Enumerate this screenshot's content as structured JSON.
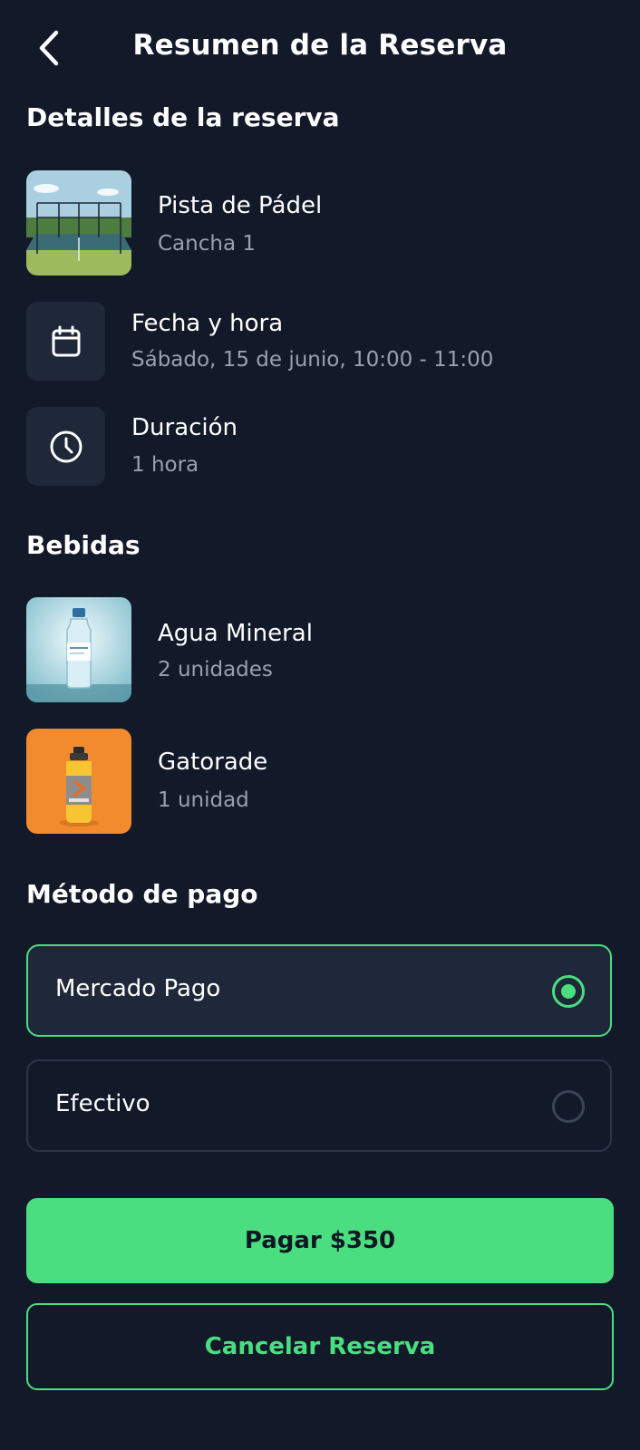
{
  "header": {
    "title": "Resumen de la Reserva",
    "back_icon": "chevron-left-icon"
  },
  "details": {
    "section_title": "Detalles de la reserva",
    "court": {
      "title": "Pista de Pádel",
      "subtitle": "Cancha 1",
      "image": "padel-court-image"
    },
    "datetime": {
      "icon": "calendar-icon",
      "title": "Fecha y hora",
      "value": "Sábado, 15 de junio, 10:00 - 11:00"
    },
    "duration": {
      "icon": "clock-icon",
      "title": "Duración",
      "value": "1 hora"
    }
  },
  "drinks": {
    "section_title": "Bebidas",
    "items": [
      {
        "name": "Agua Mineral",
        "quantity": "2 unidades",
        "image": "water-bottle-image"
      },
      {
        "name": "Gatorade",
        "quantity": "1 unidad",
        "image": "gatorade-bottle-image"
      }
    ]
  },
  "payment": {
    "section_title": "Método de pago",
    "options": [
      {
        "label": "Mercado Pago",
        "selected": true
      },
      {
        "label": "Efectivo",
        "selected": false
      }
    ]
  },
  "actions": {
    "pay_label": "Pagar $350",
    "cancel_label": "Cancelar Reserva"
  },
  "colors": {
    "background": "#121929",
    "card": "#1e2838",
    "accent": "#4ade80",
    "muted_text": "#98a1b0"
  }
}
